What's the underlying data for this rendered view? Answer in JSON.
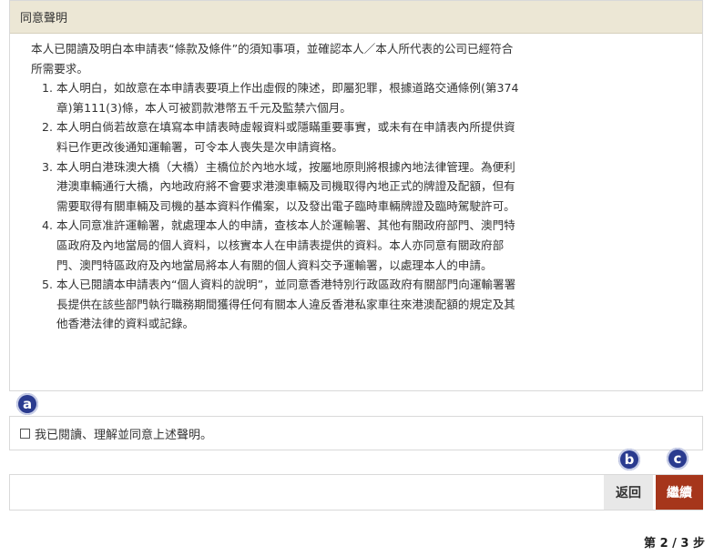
{
  "panel": {
    "title": "同意聲明",
    "intro": "本人已閱讀及明白本申請表“條款及條件”的須知事項，並確認本人／本人所代表的公司已經符合所需要求。",
    "items": [
      "本人明白，如故意在本申請表要項上作出虛假的陳述，即屬犯罪，根據道路交通條例(第374章)第111(3)條，本人可被罰款港幣五千元及監禁六個月。",
      "本人明白倘若故意在填寫本申請表時虛報資料或隱瞞重要事實，或未有在申請表內所提供資料已作更改後通知運輸署，可令本人喪失是次申請資格。",
      "本人明白港珠澳大橋（大橋）主橋位於內地水域，按屬地原則將根據內地法律管理。為便利港澳車輛通行大橋，內地政府將不會要求港澳車輛及司機取得內地正式的牌證及配額，但有需要取得有關車輛及司機的基本資料作備案，以及發出電子臨時車輛牌證及臨時駕駛許可。",
      "本人同意准許運輸署，就處理本人的申請，查核本人於運輸署、其他有關政府部門、澳門特區政府及內地當局的個人資料，以核實本人在申請表提供的資料。本人亦同意有關政府部門、澳門特區政府及內地當局將本人有關的個人資料交予運輸署，以處理本人的申請。",
      "本人已閱讀本申請表內“個人資料的說明”，並同意香港特別行政區政府有關部門向運輸署署長提供在該些部門執行職務期間獲得任何有關本人違反香港私家車往來港澳配額的規定及其他香港法律的資料或記錄。"
    ]
  },
  "markers": {
    "a": "a",
    "b": "b",
    "c": "c"
  },
  "agree": {
    "label": "我已閱讀、理解並同意上述聲明。"
  },
  "actions": {
    "back_label": "返回",
    "next_label": "繼續"
  },
  "step": {
    "text": "第 2 / 3 步"
  },
  "colors": {
    "header_bg": "#ece7d5",
    "next_button": "#a6361b",
    "marker": "#2a3b8f"
  }
}
